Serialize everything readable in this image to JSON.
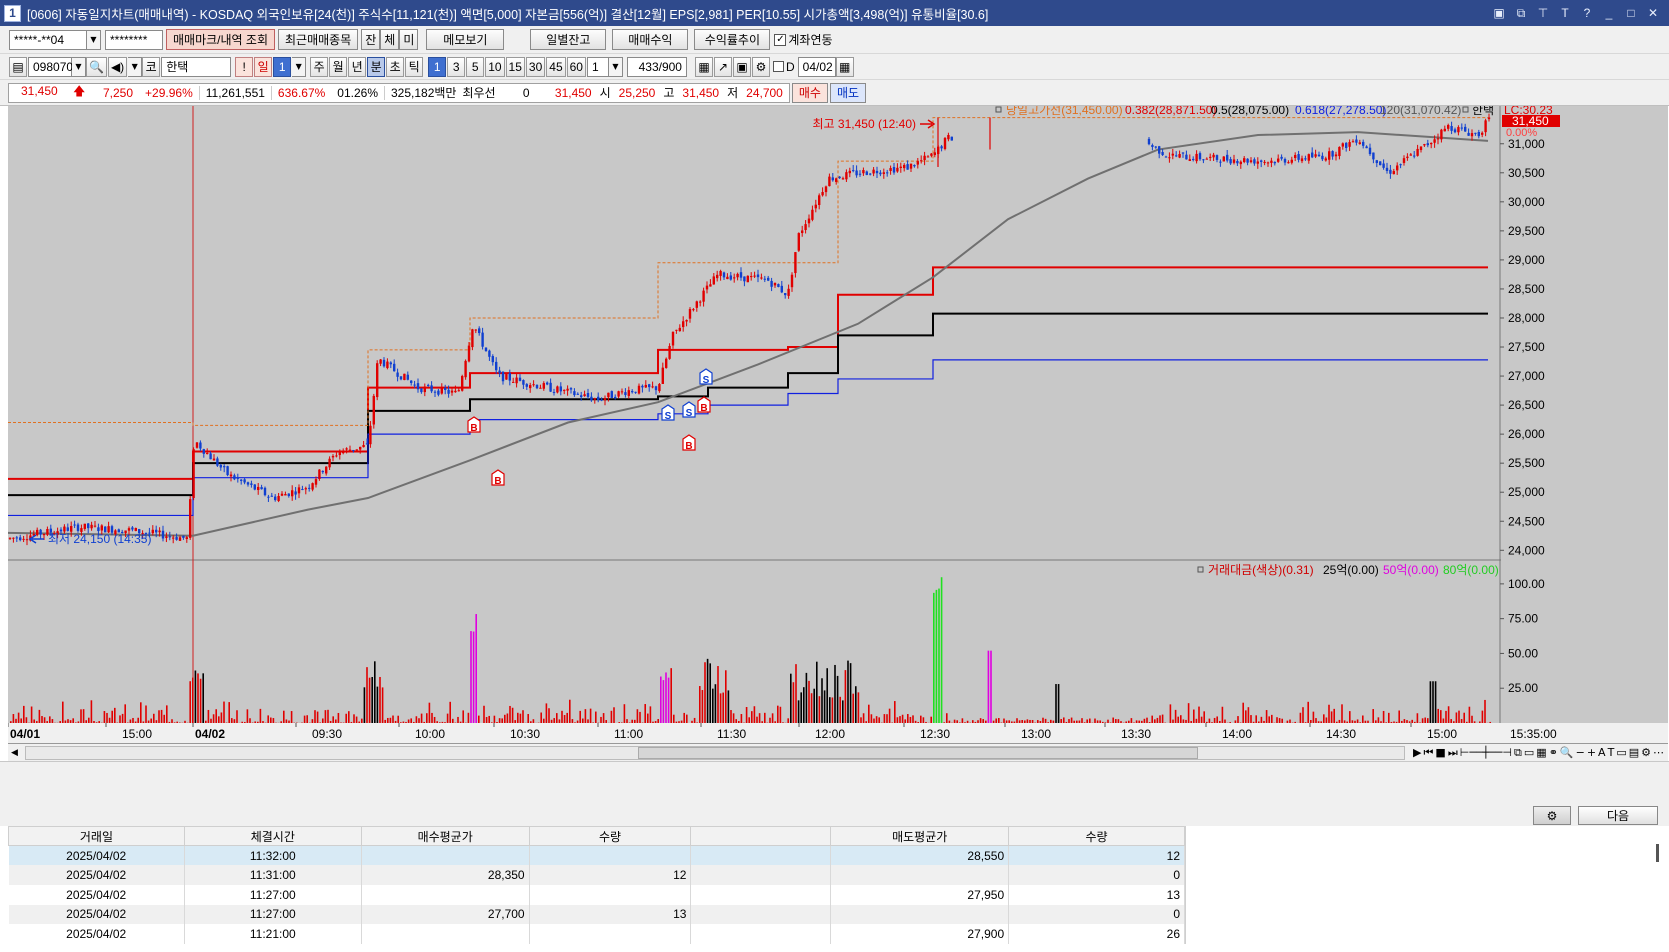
{
  "window": {
    "icon": "1",
    "title": "[0606] 자동일지차트(매매내역) - KOSDAQ 외국인보유[24(천)] 주식수[11,121(천)] 액면[5,000] 자본금[556(억)] 결산[12월] EPS[2,981] PER[10.55] 시가총액[3,498(억)] 유통비율[30.6]",
    "controls": [
      "▣",
      "⧉",
      "⊤",
      "T",
      "?",
      "_",
      "□",
      "✕"
    ]
  },
  "toolbar1": {
    "account": "*****-**04",
    "password": "********",
    "btn_trade_mark": "매매마크/내역 조회",
    "btn_recent": "최근매매종목",
    "btn_jan": "잔",
    "btn_che": "체",
    "btn_mi": "미",
    "btn_memo": "메모보기",
    "btn_daily": "일별잔고",
    "btn_profit": "매매수익",
    "btn_rate": "수익률추이",
    "chk_link": "계좌연동"
  },
  "toolbar2": {
    "code": "098070",
    "market": "코",
    "name": "한택",
    "excl": "!",
    "il": "일",
    "n1": "1",
    "periods": [
      "주",
      "월",
      "년",
      "분",
      "초",
      "틱"
    ],
    "minutes": [
      "1",
      "3",
      "5",
      "10",
      "15",
      "30",
      "45",
      "60"
    ],
    "minute_sel": "1",
    "count": "433",
    "count_total": "/900",
    "d_label": "D",
    "date": "04/02"
  },
  "quote": {
    "price": "31,450",
    "change": "7,250",
    "pct": "+29.96%",
    "volume": "11,261,551",
    "turn": "636.67%",
    "ratio": "01.26%",
    "amount": "325,182백만",
    "priority_label": "최우선",
    "priority_val": "0",
    "price2": "31,450",
    "open_label": "시",
    "open": "25,250",
    "high_label": "고",
    "high": "31,450",
    "low_label": "저",
    "low": "24,700",
    "buy": "매수",
    "sell": "매도"
  },
  "chart_data": {
    "type": "candlestick",
    "stock": "한택",
    "price_legend": {
      "main": "당일고가선(31,450.00)",
      "l382": "0.382(28,871.50)",
      "l50": "0.5(28,075.00)",
      "l618": "0.618(27,278.50)",
      "ma120": "120(31,070.42)",
      "name": "한택",
      "lc": "LC:30.23",
      "last": "31,450",
      "last_pct": "0.00%"
    },
    "y_ticks": [
      "31,000",
      "30,500",
      "30,000",
      "29,500",
      "29,000",
      "28,500",
      "28,000",
      "27,500",
      "27,000",
      "26,500",
      "26,000",
      "25,500",
      "25,000",
      "24,500",
      "24,000"
    ],
    "annotations": {
      "high": "최고 31,450 (12:40)",
      "low": "최저 24,150 (14:35)"
    },
    "x_ticks": [
      "04/01",
      "15:00",
      "04/02",
      "09:30",
      "10:00",
      "10:30",
      "11:00",
      "11:30",
      "12:00",
      "12:30",
      "13:00",
      "13:30",
      "14:00",
      "14:30",
      "15:00",
      "15:35:00"
    ],
    "volume_legend": {
      "main": "거래대금(색상)(0.31)",
      "v25": "25억(0.00)",
      "v50": "50억(0.00)",
      "v80": "80억(0.00)"
    },
    "volume_ticks": [
      "100.00",
      "75.00",
      "50.00",
      "25.00"
    ],
    "trade_marks": [
      "B",
      "B",
      "S",
      "B",
      "S",
      "B",
      "B",
      "S"
    ],
    "colors": {
      "up": "#e00000",
      "down": "#1040d0",
      "fib382": "#e00000",
      "fib50": "#000000",
      "fib618": "#1020e0",
      "ma": "#707070",
      "high": "#e07020"
    }
  },
  "nav": {
    "next": "다음"
  },
  "table": {
    "headers": [
      "거래일",
      "체결시간",
      "매수평균가",
      "수량",
      "",
      "매도평균가",
      "수량"
    ],
    "rows": [
      [
        "2025/04/02",
        "11:32:00",
        "",
        "",
        "",
        "28,550",
        "12"
      ],
      [
        "2025/04/02",
        "11:31:00",
        "28,350",
        "12",
        "",
        "",
        "0"
      ],
      [
        "2025/04/02",
        "11:27:00",
        "",
        "",
        "",
        "27,950",
        "13"
      ],
      [
        "2025/04/02",
        "11:27:00",
        "27,700",
        "13",
        "",
        "",
        "0"
      ],
      [
        "2025/04/02",
        "11:21:00",
        "",
        "",
        "",
        "27,900",
        "26"
      ]
    ]
  }
}
